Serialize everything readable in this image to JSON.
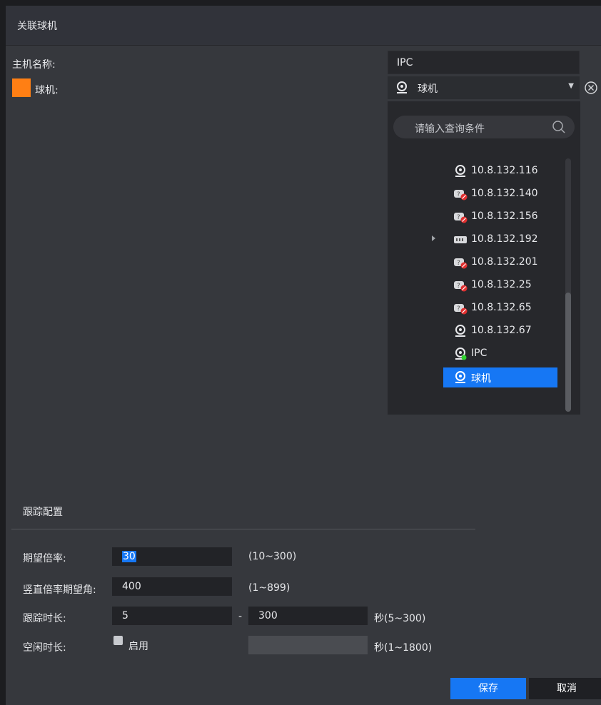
{
  "window": {
    "title": "关联球机"
  },
  "host": {
    "label": "主机名称:",
    "value": "IPC"
  },
  "ptz": {
    "label": "球机:",
    "selected": "球机",
    "swatch_color": "#ff7f14"
  },
  "dropdown": {
    "search_placeholder": "请输入查询条件",
    "items": [
      {
        "label": "10.8.132.116",
        "icon": "camera-icon"
      },
      {
        "label": "10.8.132.140",
        "icon": "device-offline-icon"
      },
      {
        "label": "10.8.132.156",
        "icon": "device-offline-icon"
      },
      {
        "label": "10.8.132.192",
        "icon": "nvr-icon"
      },
      {
        "label": "10.8.132.201",
        "icon": "device-offline-icon"
      },
      {
        "label": "10.8.132.25",
        "icon": "device-offline-icon"
      },
      {
        "label": "10.8.132.65",
        "icon": "device-offline-icon"
      },
      {
        "label": "10.8.132.67",
        "icon": "camera-icon"
      },
      {
        "label": "IPC",
        "icon": "camera-online-icon"
      },
      {
        "label": "球机",
        "icon": "camera-icon",
        "selected": true
      }
    ]
  },
  "tracking": {
    "title": "跟踪配置",
    "zoom": {
      "label": "期望倍率:",
      "value": "30",
      "range": "(10~300)"
    },
    "vertical": {
      "label": "竖直倍率期望角:",
      "value": "400",
      "range": "(1~899)"
    },
    "duration": {
      "label": "跟踪时长:",
      "min": "5",
      "sep": "-",
      "max": "300",
      "range": "秒(5~300)"
    },
    "idle": {
      "label": "空闲时长:",
      "enable_label": "启用",
      "range": "秒(1~1800)"
    }
  },
  "buttons": {
    "save": "保存",
    "cancel": "取消"
  },
  "colors": {
    "accent": "#1677f4",
    "background": "#36383d"
  }
}
